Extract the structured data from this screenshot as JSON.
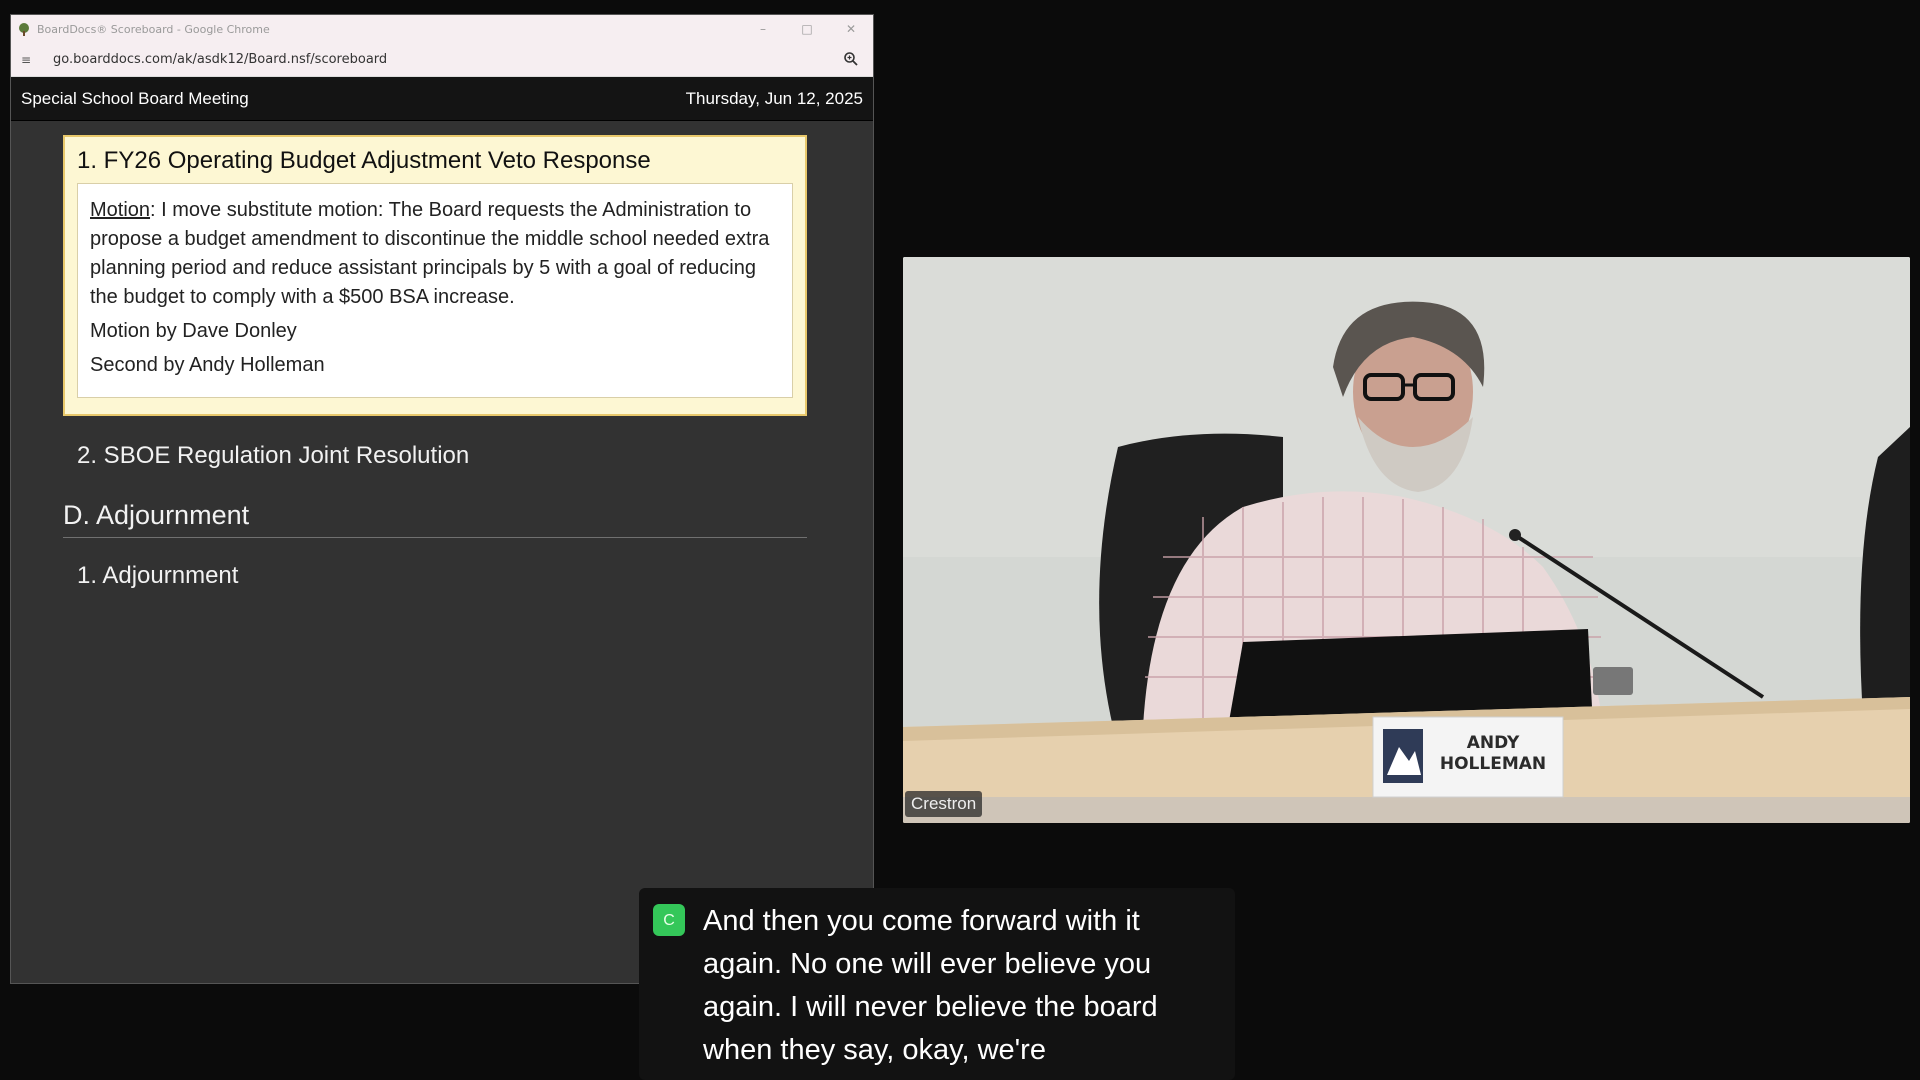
{
  "window": {
    "title": "BoardDocs® Scoreboard - Google Chrome",
    "url": "go.boarddocs.com/ak/asdk12/Board.nsf/scoreboard"
  },
  "header": {
    "meeting": "Special School Board Meeting",
    "date": "Thursday, Jun 12, 2025"
  },
  "agenda": {
    "active_item": {
      "title": "1. FY26 Operating Budget Adjustment Veto Response",
      "motion_label": "Motion",
      "motion_text": ": I move substitute motion: The Board requests the Administration to propose a budget amendment to discontinue the middle school needed extra planning period and reduce assistant principals by 5 with a goal of reducing the budget to comply with a $500 BSA increase.",
      "motion_by": "Motion by Dave Donley",
      "second_by": "Second by Andy Holleman"
    },
    "item2": "2. SBOE Regulation Joint Resolution",
    "section_d": "D. Adjournment",
    "item_adjournment": "1. Adjournment"
  },
  "video": {
    "source_label": "Crestron",
    "nameplate_line1": "ANDY",
    "nameplate_line2": "HOLLEMAN"
  },
  "caption": {
    "badge": "C",
    "text": "And then you come forward with it again. No one will ever believe you again. I will never believe the board when they say, okay, we're"
  }
}
